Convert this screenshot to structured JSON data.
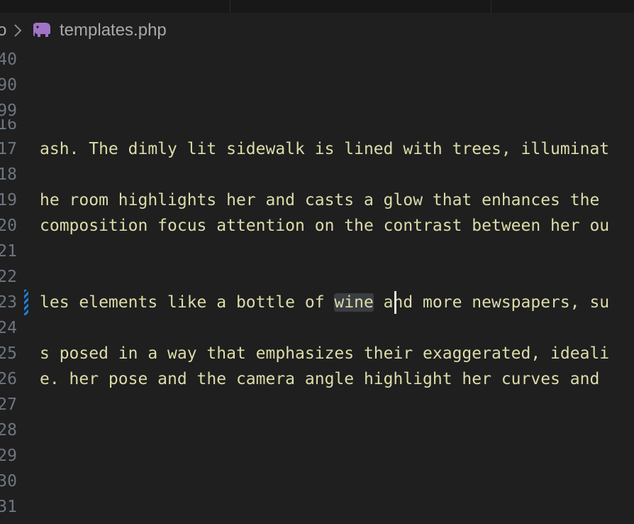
{
  "breadcrumb": {
    "prev_label": "o",
    "file_label": "templates.php",
    "file_icon": "php-elephant-icon",
    "icon_color": "#a074c4"
  },
  "gutter": {
    "lines": [
      "40",
      "90",
      "99",
      "16",
      "17",
      "18",
      "19",
      "20",
      "21",
      "22",
      "23",
      "24",
      "25",
      "26",
      "27",
      "28",
      "29",
      "30",
      "31"
    ]
  },
  "code": {
    "line17": "ash. The dimly lit sidewalk is lined with trees, illuminat",
    "line19": "he room highlights her and casts a glow that enhances the",
    "line20": "composition focus attention on the contrast between her ou",
    "line23_before": "les elements like a bottle of ",
    "line23_selected": "wine",
    "line23_after": " and more newspapers, su",
    "line25": "s posed in a way that emphasizes their exaggerated, ideali",
    "line26": "e. her pose and the camera angle highlight her curves and"
  },
  "colors": {
    "background": "#1f1f1f",
    "code_text": "#dcdcaa",
    "line_numbers": "#6e7681",
    "selection": "#3a3d41",
    "change_marker": "#1b81d8"
  }
}
